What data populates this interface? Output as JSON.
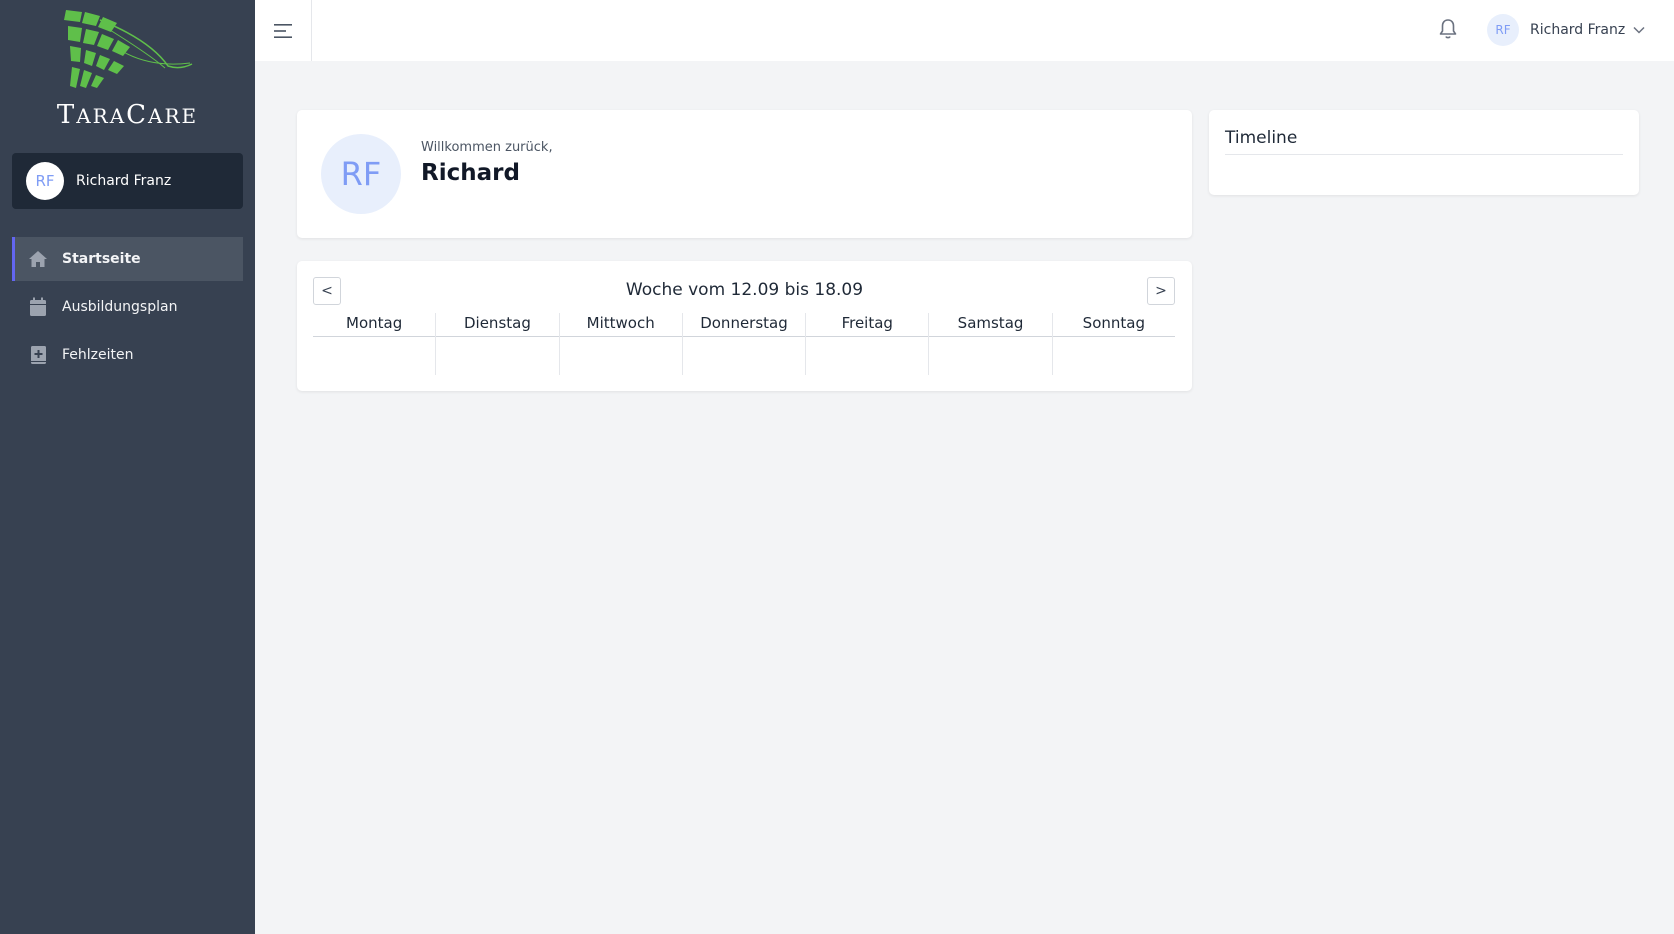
{
  "brand": {
    "logo_text_first": "T",
    "logo_text_rest": "ARA",
    "logo_text_cap2": "C",
    "logo_text_rest2": "ARE"
  },
  "sidebar": {
    "user": {
      "initials": "RF",
      "name": "Richard Franz"
    },
    "items": [
      {
        "label": "Startseite",
        "icon": "home-icon",
        "active": true
      },
      {
        "label": "Ausbildungsplan",
        "icon": "calendar-icon",
        "active": false
      },
      {
        "label": "Fehlzeiten",
        "icon": "medical-book-icon",
        "active": false
      }
    ]
  },
  "header": {
    "user": {
      "initials": "RF",
      "name": "Richard Franz"
    }
  },
  "welcome": {
    "initials": "RF",
    "greeting": "Willkommen zurück,",
    "name": "Richard"
  },
  "timeline": {
    "title": "Timeline"
  },
  "calendar": {
    "title": "Woche vom 12.09 bis 18.09",
    "prev_label": "<",
    "next_label": ">",
    "days": [
      "Montag",
      "Dienstag",
      "Mittwoch",
      "Donnerstag",
      "Freitag",
      "Samstag",
      "Sonntag"
    ]
  },
  "colors": {
    "sidebar": "#374151",
    "accent": "#6366f1",
    "logo_green": "#5fbf4a"
  }
}
